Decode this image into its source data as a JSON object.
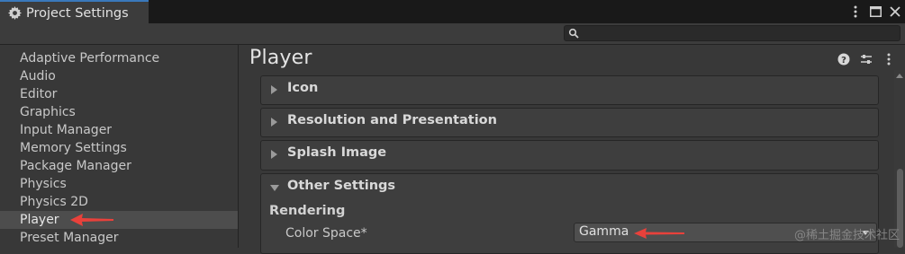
{
  "window": {
    "title": "Project Settings",
    "menu_icon": "kebab-menu-icon",
    "maximize_icon": "maximize-icon",
    "close_icon": "close-icon"
  },
  "search": {
    "placeholder": "",
    "icon": "search-icon"
  },
  "sidebar": {
    "items": [
      {
        "label": "Adaptive Performance"
      },
      {
        "label": "Audio"
      },
      {
        "label": "Editor"
      },
      {
        "label": "Graphics"
      },
      {
        "label": "Input Manager"
      },
      {
        "label": "Memory Settings"
      },
      {
        "label": "Package Manager"
      },
      {
        "label": "Physics"
      },
      {
        "label": "Physics 2D"
      },
      {
        "label": "Player",
        "selected": true
      },
      {
        "label": "Preset Manager"
      }
    ]
  },
  "main": {
    "title": "Player",
    "header_icons": [
      "help-icon",
      "preset-sliders-icon",
      "more-options-icon"
    ],
    "sections": [
      {
        "label": "Icon",
        "expanded": false
      },
      {
        "label": "Resolution and Presentation",
        "expanded": false
      },
      {
        "label": "Splash Image",
        "expanded": false
      },
      {
        "label": "Other Settings",
        "expanded": true
      }
    ],
    "rendering": {
      "heading": "Rendering",
      "color_space_label": "Color Space*",
      "color_space_value": "Gamma"
    }
  },
  "annotations": {
    "arrow_color": "#e8413b"
  },
  "watermark": "@稀土掘金技术社区",
  "colors": {
    "accent": "#3a79bb",
    "background": "#383838",
    "selected_row": "#4d4d4d"
  }
}
